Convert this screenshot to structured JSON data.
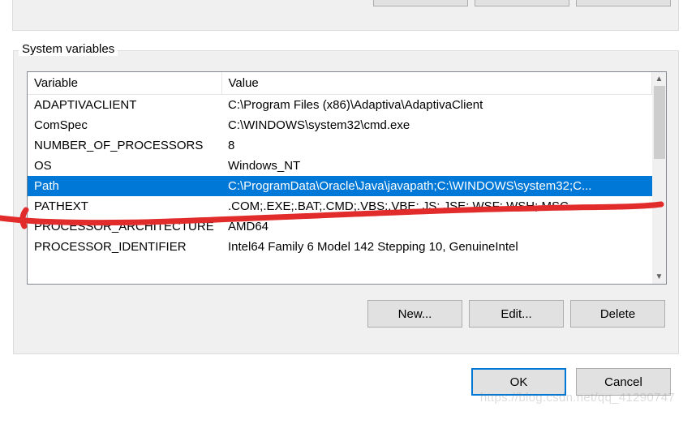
{
  "group_title": "System variables",
  "columns": {
    "c1": "Variable",
    "c2": "Value"
  },
  "rows": [
    {
      "name": "ADAPTIVACLIENT",
      "value": "C:\\Program Files (x86)\\Adaptiva\\AdaptivaClient",
      "selected": false
    },
    {
      "name": "ComSpec",
      "value": "C:\\WINDOWS\\system32\\cmd.exe",
      "selected": false
    },
    {
      "name": "NUMBER_OF_PROCESSORS",
      "value": "8",
      "selected": false
    },
    {
      "name": "OS",
      "value": "Windows_NT",
      "selected": false
    },
    {
      "name": "Path",
      "value": "C:\\ProgramData\\Oracle\\Java\\javapath;C:\\WINDOWS\\system32;C...",
      "selected": true
    },
    {
      "name": "PATHEXT",
      "value": ".COM;.EXE;.BAT;.CMD;.VBS;.VBE;.JS;.JSE;.WSF;.WSH;.MSC",
      "selected": false
    },
    {
      "name": "PROCESSOR_ARCHITECTURE",
      "value": "AMD64",
      "selected": false
    },
    {
      "name": "PROCESSOR_IDENTIFIER",
      "value": "Intel64 Family 6 Model 142 Stepping 10, GenuineIntel",
      "selected": false
    }
  ],
  "buttons": {
    "new": "New...",
    "edit": "Edit...",
    "delete": "Delete",
    "ok": "OK",
    "cancel": "Cancel"
  },
  "watermark": "https://blog.csdn.net/qq_41290747"
}
